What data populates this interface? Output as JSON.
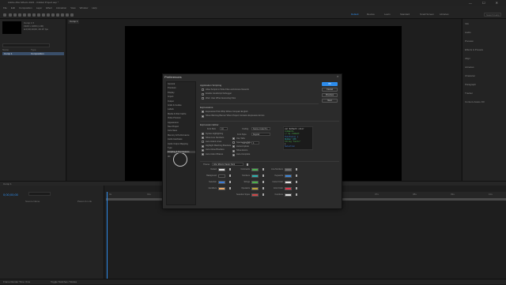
{
  "app": {
    "title": "Adobe After Effects 2023 - Untitled Project.aep *",
    "menu": [
      "File",
      "Edit",
      "Composition",
      "Layer",
      "Effect",
      "Animation",
      "View",
      "Window",
      "Help"
    ]
  },
  "workspaces": [
    "Default",
    "Review",
    "Learn",
    "Standard",
    "Small Screen",
    "Libraries"
  ],
  "workspace_active": "Default",
  "search_help_placeholder": "Search Help",
  "project": {
    "comp_name": "Comp 1 ▾",
    "comp_info_1": "1920 x 1080 (1.00)",
    "comp_info_2": "Δ 0;00;10;00, 29.97 fps",
    "header_name": "Name",
    "header_type": "Type",
    "row_name": "Comp 1",
    "row_type": "Composition"
  },
  "comp_tab": "Comp 1",
  "right_panel": [
    "Info",
    "Audio",
    "Preview",
    "Effects & Presets",
    "Align",
    "Libraries",
    "Character",
    "Paragraph",
    "Tracker",
    "Content-Aware Fill"
  ],
  "timeline": {
    "tab": "Comp 1",
    "timecode": "0;00;00;00",
    "col_source": "Source Name",
    "col_parent": "Parent & Link",
    "ruler": [
      "0s",
      "01s",
      "02s",
      "03s",
      "04s",
      "05s",
      "06s",
      "07s",
      "08s",
      "09s",
      "10s"
    ]
  },
  "status": {
    "render_time": "Frame Render Time: 0ms",
    "toggle": "Toggle Switches / Modes"
  },
  "prefs": {
    "title": "Preferences",
    "close": "×",
    "nav": [
      "General",
      "Previews",
      "Display",
      "Import",
      "Output",
      "Grids & Guides",
      "Labels",
      "Media & Disk Cache",
      "Video Preview",
      "Appearance",
      "New Project",
      "Auto-Save",
      "Memory & Performance",
      "Audio Hardware",
      "Audio Output Mapping",
      "Type",
      "Scripting & Expressions",
      "3D"
    ],
    "nav_selected": "Scripting & Expressions",
    "buttons": {
      "ok": "OK",
      "cancel": "Cancel",
      "previous": "Previous",
      "next": "Next"
    },
    "app_scripting_title": "Application Scripting",
    "app_scripting": [
      {
        "label": "Allow Scripts to Write Files and Access Network",
        "on": false
      },
      {
        "label": "Enable JavaScript Debugger",
        "on": false
      },
      {
        "label": "Warn User When Executing Files",
        "on": false
      }
    ],
    "expressions_title": "Expressions",
    "expressions": [
      {
        "label": "Expression Pick Whip Writes Compact English",
        "on": true
      },
      {
        "label": "Show Warning Banner When Project Contains Expression Errors",
        "on": true
      }
    ],
    "editor_title": "Expression Editor",
    "font_size_label": "Font Size",
    "font_size_value": "10",
    "font_label": "Coding",
    "font_value": "Source Code Pro",
    "font_style_label": "Font Style",
    "font_style_value": "Regular",
    "editor_opts": [
      {
        "label": "Syntax Highlighting",
        "on": true
      },
      {
        "label": "Show Line Numbers",
        "on": true
      },
      {
        "label": "Auto Indent Lines",
        "on": false
      },
      {
        "label": "Highlight Matching Brackets",
        "on": true
      },
      {
        "label": "Auto-Close Brackets",
        "on": true
      },
      {
        "label": "Auto-Indent Braces",
        "on": true
      }
    ],
    "editor_opts2": [
      {
        "label": "Use Tabs",
        "on": true
      },
      {
        "label": "Spaces for Tabs",
        "on": false
      },
      {
        "label": "Autocomplete",
        "on": true
      },
      {
        "label": "Show Errors",
        "on": true
      },
      {
        "label": "Auto-Complete",
        "on": true
      }
    ],
    "tab_width_label": "Tab Size",
    "tab_width_value": "4",
    "code_preview": [
      "var Default color",
      "Comments",
      "// my comment",
      "function() {",
      "   Number 100",
      "   String \"hello\"",
      "}",
      "Selection"
    ],
    "theme_label": "Theme",
    "theme_value": "After Effects Classic Dark",
    "colors": [
      {
        "label": "Default",
        "color": "#dddddd"
      },
      {
        "label": "Background",
        "color": "#1e1e1e"
      },
      {
        "label": "Selection",
        "color": "#3a7bd5"
      },
      {
        "label": "Identifiers",
        "color": "#e6a86a"
      }
    ],
    "colors2": [
      {
        "label": "Comments",
        "color": "#4caf50"
      },
      {
        "label": "Numbers",
        "color": "#2bb3b0"
      },
      {
        "label": "Strings",
        "color": "#4ab04a"
      },
      {
        "label": "Operators",
        "color": "#b9a13a"
      },
      {
        "label": "Selection Styles",
        "color": "#d04545"
      }
    ],
    "colors3": [
      {
        "label": "Line Numbers",
        "color": "#707070"
      },
      {
        "label": "Keywords",
        "color": "#3a88e0"
      },
      {
        "label": "Cursor Color",
        "color": "#e0e0e0"
      },
      {
        "label": "Error Color",
        "color": "#e0344a"
      },
      {
        "label": "Functions",
        "color": "#e0e0e0"
      }
    ]
  }
}
